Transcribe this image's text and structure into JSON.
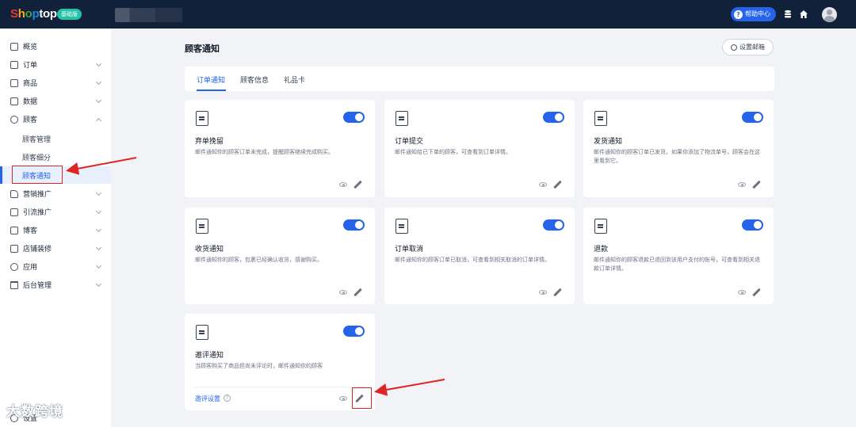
{
  "topbar": {
    "logo_text": "Shoptop",
    "logo_colors": [
      "#e53935",
      "#f9a825",
      "#43a047",
      "#1e88e5"
    ],
    "plan_badge": "基础版",
    "help_label": "帮助中心",
    "help_icon": "question-icon",
    "icons": [
      "database-icon",
      "home-icon",
      "avatar"
    ]
  },
  "sidebar": {
    "items": [
      {
        "label": "概览",
        "icon": "grid-icon"
      },
      {
        "label": "订单",
        "icon": "order-icon"
      },
      {
        "label": "商品",
        "icon": "box-icon"
      },
      {
        "label": "数据",
        "icon": "chart-icon"
      },
      {
        "label": "顾客",
        "icon": "user-icon"
      },
      {
        "label": "营销推广",
        "icon": "tag-icon"
      },
      {
        "label": "引流推广",
        "icon": "doc-icon"
      },
      {
        "label": "博客",
        "icon": "blog-icon"
      },
      {
        "label": "店铺装修",
        "icon": "store-icon"
      },
      {
        "label": "应用",
        "icon": "app-icon"
      },
      {
        "label": "后台管理",
        "icon": "folder-icon"
      }
    ],
    "customer_sub": [
      "顾客管理",
      "顾客细分",
      "顾客通知"
    ],
    "settings_label": "设置"
  },
  "main": {
    "title": "顾客通知",
    "mail_settings": "设置邮箱",
    "tabs": [
      "订单通知",
      "顾客信息",
      "礼品卡"
    ]
  },
  "cards": [
    {
      "title": "弃单挽留",
      "desc": "邮件通知你的顾客订单未完成，提醒顾客继续完成购买。",
      "enabled": true
    },
    {
      "title": "订单提交",
      "desc": "邮件通知给已下单的顾客，可查看到订单详情。",
      "enabled": true
    },
    {
      "title": "发货通知",
      "desc": "邮件通知你的顾客订单已发货。如果你添加了物流单号，顾客会在这里看到它。",
      "enabled": true
    },
    {
      "title": "收货通知",
      "desc": "邮件通知你的顾客，包裹已经确认收货，感谢购买。",
      "enabled": true
    },
    {
      "title": "订单取消",
      "desc": "邮件通知你的顾客订单已取消，可查看到相关取消的订单详情。",
      "enabled": true
    },
    {
      "title": "退款",
      "desc": "邮件通知你的顾客退款已退回到该用户支付的账号，可查看到相关退款订单详情。",
      "enabled": true
    },
    {
      "title": "邀评通知",
      "desc": "当顾客购买了商品但尚未评论时，邮件通知你的顾客",
      "enabled": true,
      "link": "邀评设置"
    }
  ],
  "watermark": "大数跨境",
  "annotation_color": "#e02424"
}
